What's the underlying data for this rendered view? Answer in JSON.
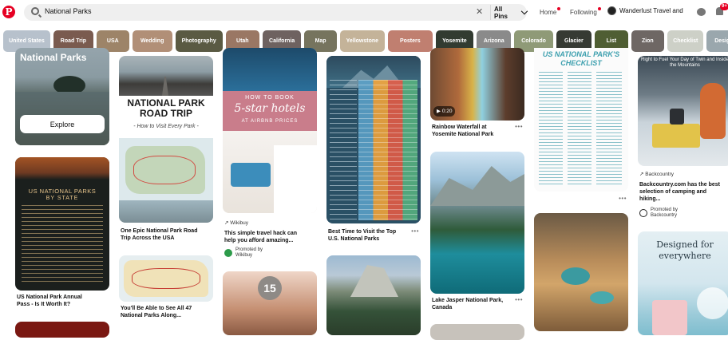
{
  "header": {
    "logo": "P",
    "search_value": "National Parks",
    "filter_label": "All Pins",
    "nav": {
      "home": "Home",
      "following": "Following"
    },
    "profile_name": "Wanderlust Travel and",
    "notification_count": "9+"
  },
  "chips": [
    {
      "label": "United States",
      "color": "#b7c1cc"
    },
    {
      "label": "Road Trip",
      "color": "#7a5b4f"
    },
    {
      "label": "USA",
      "color": "#9d8468"
    },
    {
      "label": "Wedding",
      "color": "#b18f77"
    },
    {
      "label": "Photography",
      "color": "#5a5a43"
    },
    {
      "label": "Utah",
      "color": "#9a7764"
    },
    {
      "label": "California",
      "color": "#6e6260"
    },
    {
      "label": "Map",
      "color": "#76745e"
    },
    {
      "label": "Yellowstone",
      "color": "#c4b399"
    },
    {
      "label": "Posters",
      "color": "#c07f70"
    },
    {
      "label": "Yosemite",
      "color": "#323b31"
    },
    {
      "label": "Arizona",
      "color": "#8a8a8a"
    },
    {
      "label": "Colorado",
      "color": "#8f9a77"
    },
    {
      "label": "Glacier",
      "color": "#363a33"
    },
    {
      "label": "List",
      "color": "#4f5e33"
    },
    {
      "label": "Zion",
      "color": "#6e6764"
    },
    {
      "label": "Checklist",
      "color": "#cdd0c7"
    },
    {
      "label": "Desig",
      "color": "#9aa7ad"
    }
  ],
  "pins": {
    "col1": {
      "hero_title": "National Parks",
      "explore_label": "Explore",
      "annual_pass_caption": "US National Park Annual Pass - Is It Worth It?",
      "poster_title_top": "US NATIONAL PARKS",
      "poster_title_bottom": "BY STATE"
    },
    "col2": {
      "roadtrip_title": "NATIONAL PARK ROAD TRIP",
      "roadtrip_subtitle": "- How to Visit Every Park -",
      "roadtrip_caption": "One Epic National Park Road Trip Across the USA",
      "map_caption": "You'll Be Able to See All 47 National Parks Along..."
    },
    "col3": {
      "hotel_line1": "HOW TO BOOK",
      "hotel_line2": "5-star hotels",
      "hotel_line3": "AT AIRBNB PRICES",
      "source": "Wikibuy",
      "caption": "This simple travel hack can help you afford amazing...",
      "promoted_label": "Promoted by",
      "promoter": "Wikibuy",
      "number_badge": "15"
    },
    "col4": {
      "caption": "Best Time to Visit the Top U.S. National Parks"
    },
    "col5": {
      "video_time": "0:20",
      "waterfall_caption": "Rainbow Waterfall at Yosemite National Park",
      "lake_caption": "Lake Jasper National Park, Canada"
    },
    "col6": {
      "checklist_title": "US NATIONAL PARK'S CHECKLIST"
    },
    "col7": {
      "camping_header": "Right to Fuel Your Day of Twin and Inside the Mountains",
      "source": "Backcountry",
      "caption": "Backcountry.com has the best selection of camping and hiking...",
      "promoted_label": "Promoted by",
      "promoter": "Backcountry",
      "designed_line1": "Designed for",
      "designed_line2": "everywhere"
    }
  }
}
